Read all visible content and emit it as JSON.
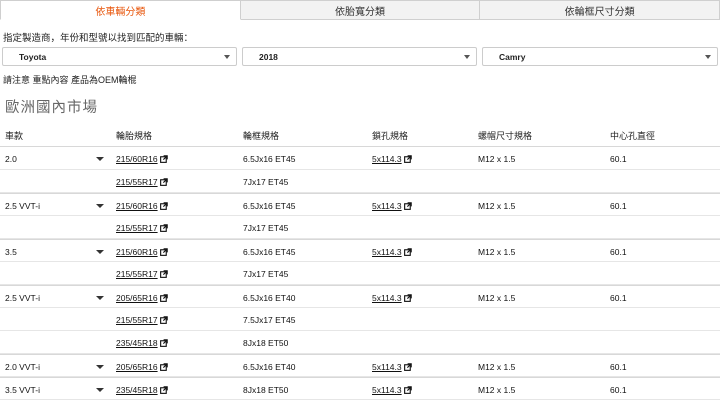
{
  "tabs": [
    {
      "label": "依車輛分類",
      "active": true
    },
    {
      "label": "依胎寬分類",
      "active": false
    },
    {
      "label": "依輪框尺寸分類",
      "active": false
    }
  ],
  "instruction": "指定製造商，年份和型號以找到匹配的車輛：",
  "selects": {
    "make": "Toyota",
    "year": "2018",
    "model": "Camry"
  },
  "note": "請注意 重點內容 產品為OEM輪棍",
  "section_title": "歐洲國內市場",
  "table": {
    "headers": [
      "車款",
      "輪胎規格",
      "輪框規格",
      "鎖孔規格",
      "螺帽尺寸規格",
      "中心孔直徑"
    ],
    "rows": [
      {
        "trim": "2.0",
        "tire": "215/60R16",
        "rim": "6.5Jx16 ET45",
        "bolt": "5x114.3",
        "thread": "M12 x 1.5",
        "cb": "60.1",
        "start": true
      },
      {
        "trim": "",
        "tire": "215/55R17",
        "rim": "7Jx17 ET45",
        "bolt": "",
        "thread": "",
        "cb": "",
        "start": false
      },
      {
        "trim": "2.5 VVT-i",
        "tire": "215/60R16",
        "rim": "6.5Jx16 ET45",
        "bolt": "5x114.3",
        "thread": "M12 x 1.5",
        "cb": "60.1",
        "start": true
      },
      {
        "trim": "",
        "tire": "215/55R17",
        "rim": "7Jx17 ET45",
        "bolt": "",
        "thread": "",
        "cb": "",
        "start": false
      },
      {
        "trim": "3.5",
        "tire": "215/60R16",
        "rim": "6.5Jx16 ET45",
        "bolt": "5x114.3",
        "thread": "M12 x 1.5",
        "cb": "60.1",
        "start": true
      },
      {
        "trim": "",
        "tire": "215/55R17",
        "rim": "7Jx17 ET45",
        "bolt": "",
        "thread": "",
        "cb": "",
        "start": false
      },
      {
        "trim": "2.5 VVT-i",
        "tire": "205/65R16",
        "rim": "6.5Jx16 ET40",
        "bolt": "5x114.3",
        "thread": "M12 x 1.5",
        "cb": "60.1",
        "start": true
      },
      {
        "trim": "",
        "tire": "215/55R17",
        "rim": "7.5Jx17 ET45",
        "bolt": "",
        "thread": "",
        "cb": "",
        "start": false
      },
      {
        "trim": "",
        "tire": "235/45R18",
        "rim": "8Jx18 ET50",
        "bolt": "",
        "thread": "",
        "cb": "",
        "start": false
      },
      {
        "trim": "2.0 VVT-i",
        "tire": "205/65R16",
        "rim": "6.5Jx16 ET40",
        "bolt": "5x114.3",
        "thread": "M12 x 1.5",
        "cb": "60.1",
        "start": true
      },
      {
        "trim": "3.5 VVT-i",
        "tire": "235/45R18",
        "rim": "8Jx18 ET50",
        "bolt": "5x114.3",
        "thread": "M12 x 1.5",
        "cb": "60.1",
        "start": true
      }
    ]
  },
  "colors": {
    "accent": "#e8560c"
  }
}
